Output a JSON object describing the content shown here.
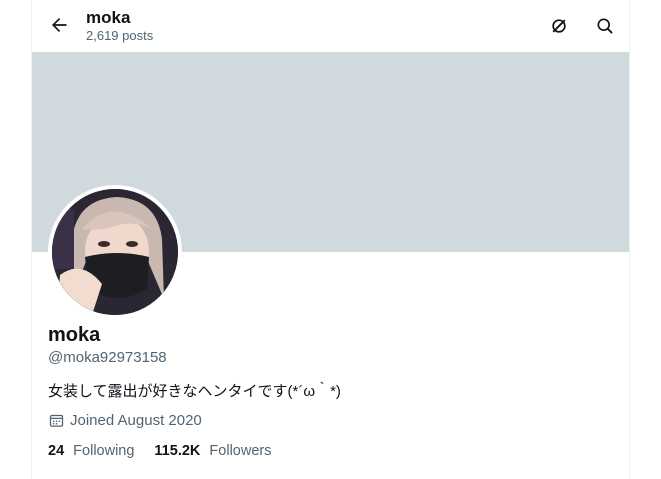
{
  "header": {
    "title": "moka",
    "post_count": "2,619 posts"
  },
  "icons": {
    "back": "arrow-left-icon",
    "grok": "grok-icon",
    "search": "search-icon",
    "calendar": "calendar-icon"
  },
  "profile": {
    "display_name": "moka",
    "handle": "@moka92973158",
    "bio": "女装して露出が好きなヘンタイです(*´ω｀*)",
    "joined": "Joined August 2020",
    "following_count": "24",
    "following_label": "Following",
    "followers_count": "115.2K",
    "followers_label": "Followers"
  },
  "colors": {
    "banner": "#cfd9de",
    "secondary_text": "#536471",
    "primary_text": "#0f1419"
  }
}
